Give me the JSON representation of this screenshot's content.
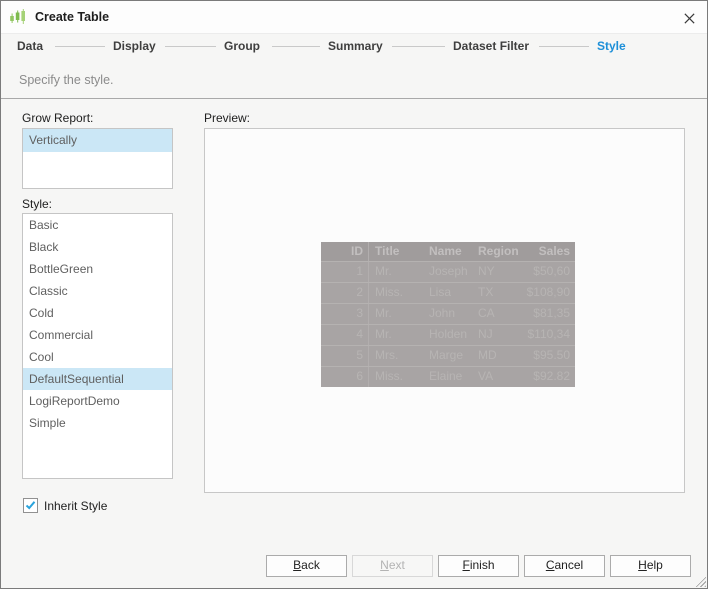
{
  "window": {
    "title": "Create Table"
  },
  "wizard": {
    "steps": [
      {
        "label": "Data"
      },
      {
        "label": "Display"
      },
      {
        "label": "Group"
      },
      {
        "label": "Summary"
      },
      {
        "label": "Dataset Filter"
      },
      {
        "label": "Style"
      }
    ],
    "active_step": "Style"
  },
  "subtitle": "Specify the style.",
  "grow_report": {
    "label": "Grow Report:",
    "items": [
      "Vertically"
    ],
    "selected": "Vertically"
  },
  "style_list": {
    "label": "Style:",
    "items": [
      "Basic",
      "Black",
      "BottleGreen",
      "Classic",
      "Cold",
      "Commercial",
      "Cool",
      "DefaultSequential",
      "LogiReportDemo",
      "Simple"
    ],
    "selected": "DefaultSequential"
  },
  "preview": {
    "label": "Preview:",
    "table": {
      "columns": [
        "ID",
        "Title",
        "Name",
        "Region",
        "Sales"
      ],
      "rows": [
        {
          "id": "1",
          "title": "Mr.",
          "name": "Joseph",
          "region": "NY",
          "sales": "$50,60"
        },
        {
          "id": "2",
          "title": "Miss.",
          "name": "Lisa",
          "region": "TX",
          "sales": "$108,90"
        },
        {
          "id": "3",
          "title": "Mr.",
          "name": "John",
          "region": "CA",
          "sales": "$81,35"
        },
        {
          "id": "4",
          "title": "Mr.",
          "name": "Holden",
          "region": "NJ",
          "sales": "$110,34"
        },
        {
          "id": "5",
          "title": "Mrs.",
          "name": "Marge",
          "region": "MD",
          "sales": "$95.50"
        },
        {
          "id": "6",
          "title": "Miss.",
          "name": "Elaine",
          "region": "VA",
          "sales": "$92.82"
        }
      ]
    }
  },
  "inherit_style": {
    "label": "Inherit Style",
    "checked": true
  },
  "buttons": {
    "back": "Back",
    "next": "Next",
    "finish": "Finish",
    "cancel": "Cancel",
    "help": "Help"
  },
  "colors": {
    "accent_blue": "#1d8fd8",
    "selection_blue": "#cbe7f6",
    "icon_green": "#7dbb4e",
    "check_blue": "#2aa3dc"
  }
}
